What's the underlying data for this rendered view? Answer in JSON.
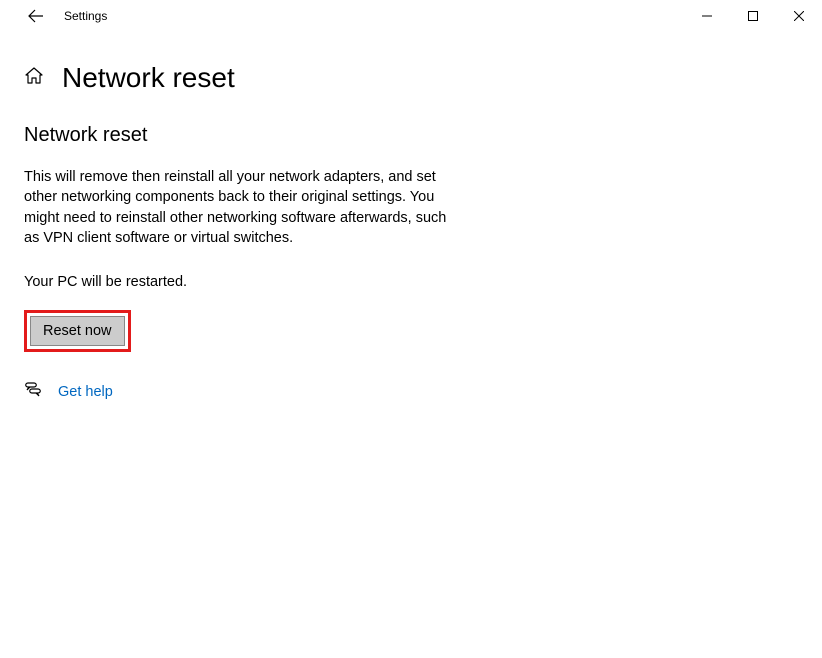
{
  "titlebar": {
    "app_name": "Settings"
  },
  "header": {
    "page_title": "Network reset"
  },
  "main": {
    "section_title": "Network reset",
    "description": "This will remove then reinstall all your network adapters, and set other networking components back to their original settings. You might need to reinstall other networking software afterwards, such as VPN client software or virtual switches.",
    "restart_note": "Your PC will be restarted.",
    "reset_button_label": "Reset now",
    "help_link_label": "Get help"
  },
  "colors": {
    "highlight_border": "#e31b1b",
    "link": "#0067c0",
    "button_bg": "#cccccc"
  }
}
